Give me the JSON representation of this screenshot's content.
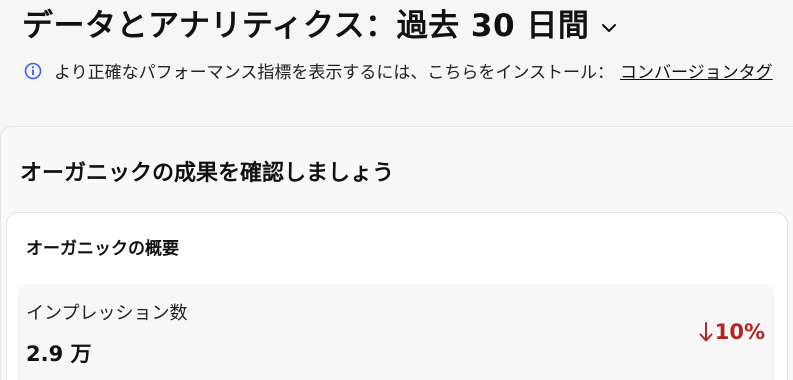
{
  "header": {
    "title": "データとアナリティクス：過去 30 日間",
    "chevron_icon": "chevron-down-icon"
  },
  "notice": {
    "icon": "info-icon",
    "text": "より正確なパフォーマンス指標を表示するには、こちらをインストール：",
    "link_text": "コンバージョンタグ"
  },
  "section": {
    "title": "オーガニックの成果を確認しましょう"
  },
  "organic_overview": {
    "title": "オーガニックの概要",
    "metrics": [
      {
        "label": "インプレッション数",
        "value": "2.9 万",
        "change": "10%",
        "direction": "down",
        "change_color": "#b3261e"
      }
    ]
  },
  "colors": {
    "info_icon": "#3d5afe",
    "negative": "#b3261e"
  }
}
